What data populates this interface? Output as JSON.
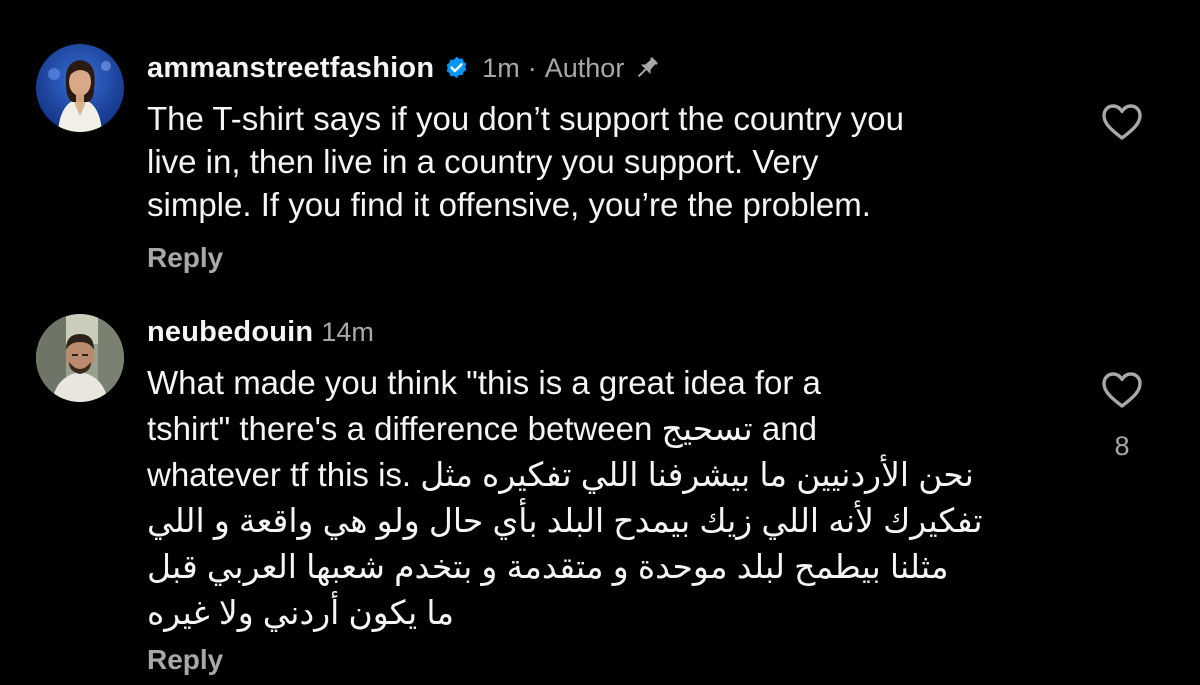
{
  "colors": {
    "background": "#000000",
    "text_primary": "#f5f5f5",
    "text_secondary": "#a8a8a8",
    "verified_blue": "#0095f6"
  },
  "comments": [
    {
      "username": "ammanstreetfashion",
      "verified": true,
      "time": "1m",
      "separator": "·",
      "role": "Author",
      "pinned": true,
      "text_lines": [
        "The T-shirt says if you don’t support the country you",
        "live in, then live in a country you support. Very",
        "simple. If you find it offensive, you’re the problem."
      ],
      "reply_label": "Reply",
      "like_icon": "heart-outline-icon",
      "avatar": "woman-in-white-blazer-avatar"
    },
    {
      "username": "neubedouin",
      "verified": false,
      "time": "14m",
      "text_lines": [
        "What made you think \"this is a great idea for a",
        "tshirt\" there's a difference between تسحيج and",
        "whatever tf this is. نحن الأردنيين ما بيشرفنا اللي تفكيره مثل",
        "تفكيرك لأنه اللي زيك بيمدح البلد بأي حال ولو هي واقعة و اللي",
        "مثلنا بيطمح لبلد موحدة و متقدمة و بتخدم شعبها العربي قبل",
        "ما يكون أردني ولا غيره"
      ],
      "reply_label": "Reply",
      "like_icon": "heart-outline-icon",
      "like_count": "8",
      "avatar": "man-in-car-avatar"
    }
  ]
}
